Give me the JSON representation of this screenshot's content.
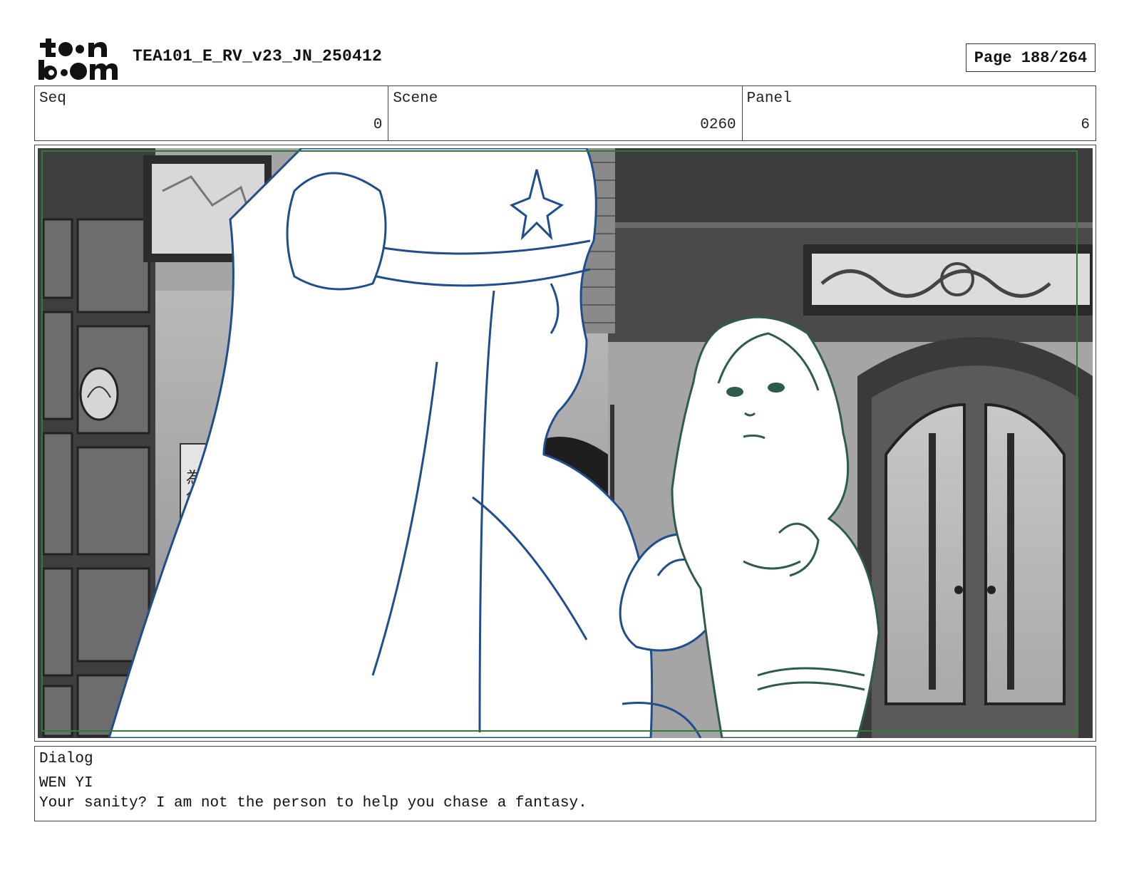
{
  "header": {
    "logo_text": "toonboom",
    "doc_title": "TEA101_E_RV_v23_JN_250412",
    "page": "Page 188/264"
  },
  "info": {
    "seq_label": "Seq",
    "seq_value": "0",
    "scene_label": "Scene",
    "scene_value": "0260",
    "panel_label": "Panel",
    "panel_value": "6"
  },
  "panel_art": {
    "description_icon": "storyboard-frame",
    "safe_frame_color": "#2e7d32",
    "foreground_line_color": "#1f4e8c",
    "character_line_color": "#2f5a4e"
  },
  "dialog": {
    "label": "Dialog",
    "speaker": "WEN YI",
    "line": "Your sanity? I am not the person to help you chase a fantasy."
  }
}
